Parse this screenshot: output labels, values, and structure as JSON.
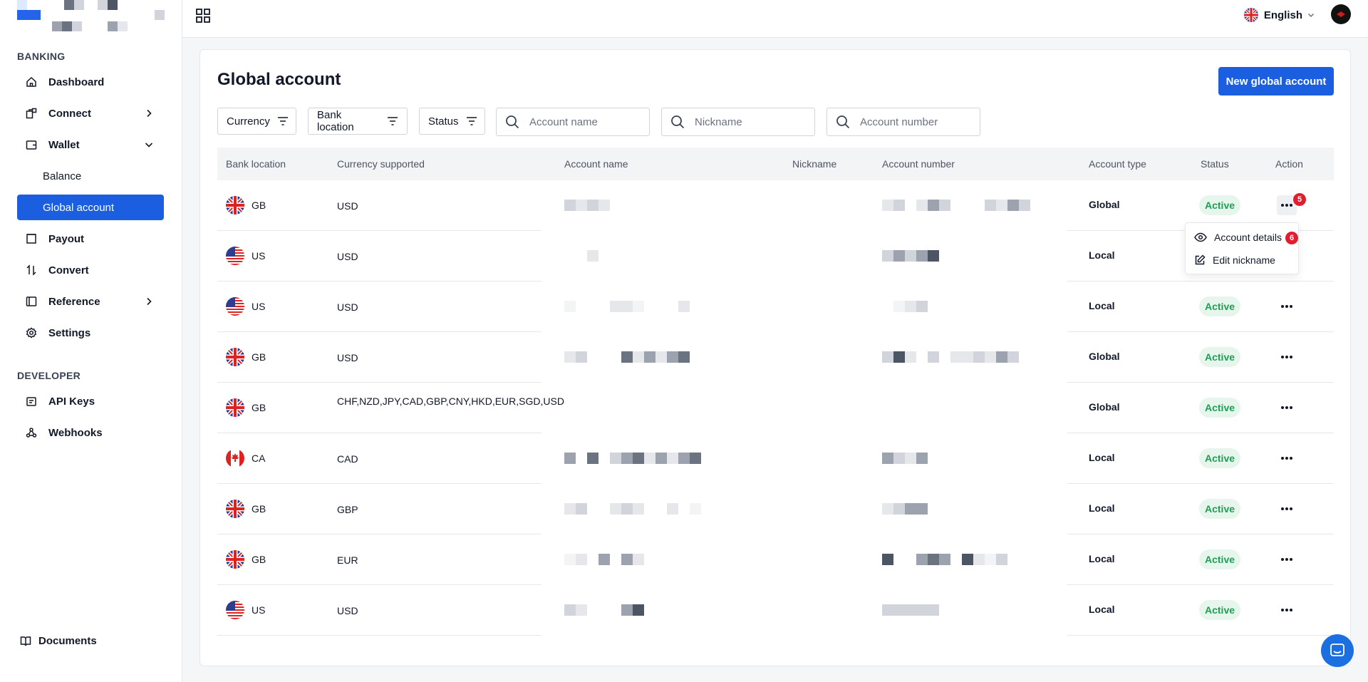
{
  "sidebar": {
    "sections": {
      "banking": "BANKING",
      "developer": "DEVELOPER"
    },
    "items": {
      "dashboard": "Dashboard",
      "connect": "Connect",
      "wallet": "Wallet",
      "balance": "Balance",
      "global_account": "Global account",
      "payout": "Payout",
      "convert": "Convert",
      "reference": "Reference",
      "settings": "Settings",
      "api_keys": "API Keys",
      "webhooks": "Webhooks",
      "documents": "Documents"
    }
  },
  "header": {
    "language": "English"
  },
  "main": {
    "title": "Global account",
    "new_button": "New global account",
    "filters": {
      "currency": "Currency",
      "bank_location": "Bank location",
      "status": "Status"
    },
    "search": {
      "account_name": "Account name",
      "nickname": "Nickname",
      "account_number": "Account number"
    },
    "columns": {
      "bank_location": "Bank location",
      "currency": "Currency supported",
      "account_name": "Account name",
      "nickname": "Nickname",
      "account_number": "Account number",
      "account_type": "Account type",
      "status": "Status",
      "action": "Action"
    },
    "rows": [
      {
        "loc": "GB",
        "flag": "gb",
        "currency": "USD",
        "type": "Global",
        "status": "Active"
      },
      {
        "loc": "US",
        "flag": "us",
        "currency": "USD",
        "type": "Local",
        "status": "Active"
      },
      {
        "loc": "US",
        "flag": "us",
        "currency": "USD",
        "type": "Local",
        "status": "Active"
      },
      {
        "loc": "GB",
        "flag": "gb",
        "currency": "USD",
        "type": "Global",
        "status": "Active"
      },
      {
        "loc": "GB",
        "flag": "gb",
        "currency": "CHF,NZD,JPY,CAD,GBP,CNY,HKD,EUR,SGD,USD",
        "type": "Global",
        "status": "Active"
      },
      {
        "loc": "CA",
        "flag": "ca",
        "currency": "CAD",
        "type": "Local",
        "status": "Active"
      },
      {
        "loc": "GB",
        "flag": "gb",
        "currency": "GBP",
        "type": "Local",
        "status": "Active"
      },
      {
        "loc": "GB",
        "flag": "gb",
        "currency": "EUR",
        "type": "Local",
        "status": "Active"
      },
      {
        "loc": "US",
        "flag": "us",
        "currency": "USD",
        "type": "Local",
        "status": "Active"
      }
    ],
    "action_menu": {
      "account_details": "Account details",
      "edit_nickname": "Edit nickname"
    },
    "step_badges": {
      "action_button": "5",
      "account_details": "6"
    }
  },
  "colors": {
    "accent": "#1b5fe0",
    "active_bg": "#e7f6ec",
    "active_text": "#1f9d55",
    "step_badge": "#e11d2e"
  },
  "icons": {
    "sidebar": [
      "home-icon",
      "connect-icon",
      "wallet-icon",
      "payout-icon",
      "convert-icon",
      "reference-icon",
      "gear-icon",
      "key-icon",
      "webhook-icon",
      "book-icon"
    ],
    "header": [
      "grid-icon",
      "uk-flag-icon",
      "chevron-down-icon",
      "avatar"
    ],
    "table": [
      "filter-icon",
      "search-icon",
      "more-horizontal-icon",
      "eye-icon",
      "edit-icon"
    ],
    "help": "chat-icon"
  }
}
